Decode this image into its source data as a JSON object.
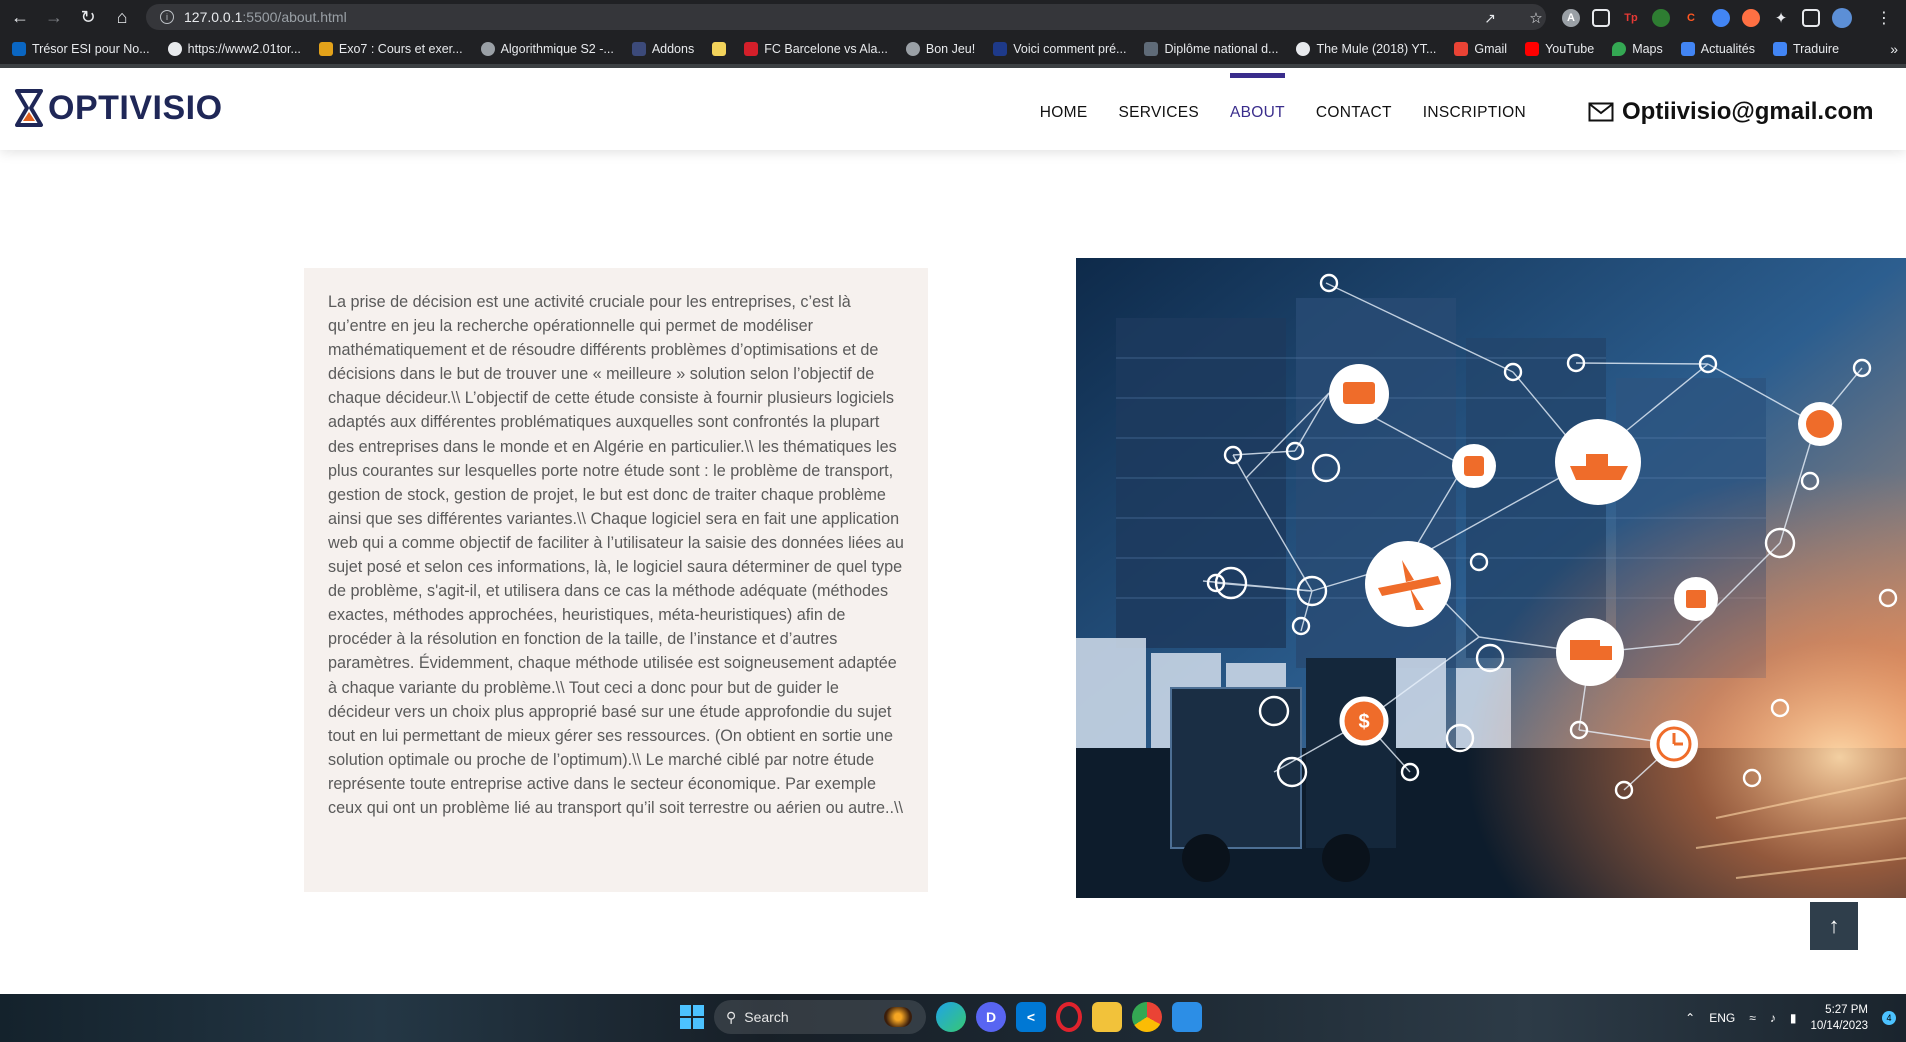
{
  "browser": {
    "back_icon": "arrow-left-icon",
    "url_host": "127.0.0.1",
    "url_path": ":5500/about.html",
    "bookmarks": [
      {
        "label": "Trésor ESI pour No...",
        "color": "#0a66c2"
      },
      {
        "label": "https://www2.01tor...",
        "color": "#ffffff"
      },
      {
        "label": "Exo7 : Cours et exer...",
        "color": "#e3a21a"
      },
      {
        "label": "Algorithmique S2 -...",
        "color": "#9aa0a6"
      },
      {
        "label": "Addons",
        "color": "#3c4a7a"
      },
      {
        "label": "",
        "color": "#f2d35b"
      },
      {
        "label": "FC Barcelone vs Ala...",
        "color": "#d41f2a"
      },
      {
        "label": "Bon Jeu!",
        "color": "#9aa0a6"
      },
      {
        "label": "Voici comment pré...",
        "color": "#1e3a8a"
      },
      {
        "label": "Diplôme national d...",
        "color": "#5f6b78"
      },
      {
        "label": "The Mule (2018) YT...",
        "color": "#ffffff"
      },
      {
        "label": "Gmail",
        "color": "#ea4335"
      },
      {
        "label": "YouTube",
        "color": "#ff0000"
      },
      {
        "label": "Maps",
        "color": "#34a853"
      },
      {
        "label": "Actualités",
        "color": "#4285f4"
      },
      {
        "label": "Traduire",
        "color": "#4285f4"
      }
    ]
  },
  "site": {
    "logo_text": "OPTIVISIO",
    "nav": {
      "home": "HOME",
      "services": "SERVICES",
      "about": "ABOUT",
      "contact": "CONTACT",
      "inscription": "INSCRIPTION"
    },
    "email": "Optiivisio@gmail.com",
    "about_text": "La prise de décision est une activité cruciale pour les entreprises, c’est là qu’entre en jeu la recherche opérationnelle qui permet de modéliser mathématiquement et de résoudre différents problèmes d’optimisations et de décisions dans le but de trouver une « meilleure » solution selon l’objectif de chaque décideur.\\\\ L’objectif de cette étude consiste à fournir plusieurs logiciels adaptés aux différentes problématiques auxquelles sont confrontés la plupart des entreprises dans le monde et en Algérie en particulier.\\\\ les thématiques les plus courantes sur lesquelles porte notre étude sont : le problème de transport, gestion de stock, gestion de projet, le but est donc de traiter chaque problème ainsi que ses différentes variantes.\\\\ Chaque logiciel sera en fait une application web qui a comme objectif de faciliter à l’utilisateur la saisie des données liées au sujet posé et selon ces informations, là, le logiciel saura déterminer de quel type de problème, s'agit-il, et utilisera dans ce cas la méthode adéquate (méthodes exactes, méthodes approchées, heuristiques, méta-heuristiques) afin de procéder à la résolution en fonction de la taille, de l’instance et d’autres paramètres. Évidemment, chaque méthode utilisée est soigneusement adaptée à chaque variante du problème.\\\\ Tout ceci a donc pour but de guider le décideur vers un choix plus approprié basé sur une étude approfondie du sujet tout en lui permettant de mieux gérer ses ressources. (On obtient en sortie une solution optimale ou proche de l’optimum).\\\\ Le marché ciblé par notre étude représente toute entreprise active dans le secteur économique. Par exemple ceux qui ont un problème lié au transport qu’il soit terrestre ou aérien ou autre..\\\\",
    "hero_image": "logistics-network-image",
    "to_top_icon": "arrow-up-icon"
  },
  "taskbar": {
    "search_label": "Search",
    "language": "ENG",
    "time": "5:27 PM",
    "date": "10/14/2023",
    "notification_count": "4"
  },
  "colors": {
    "brand": "#1f2757",
    "nav_active": "#3a2d8c",
    "about_bg": "#f6f1ee",
    "to_top_bg": "#2f3e4b"
  }
}
